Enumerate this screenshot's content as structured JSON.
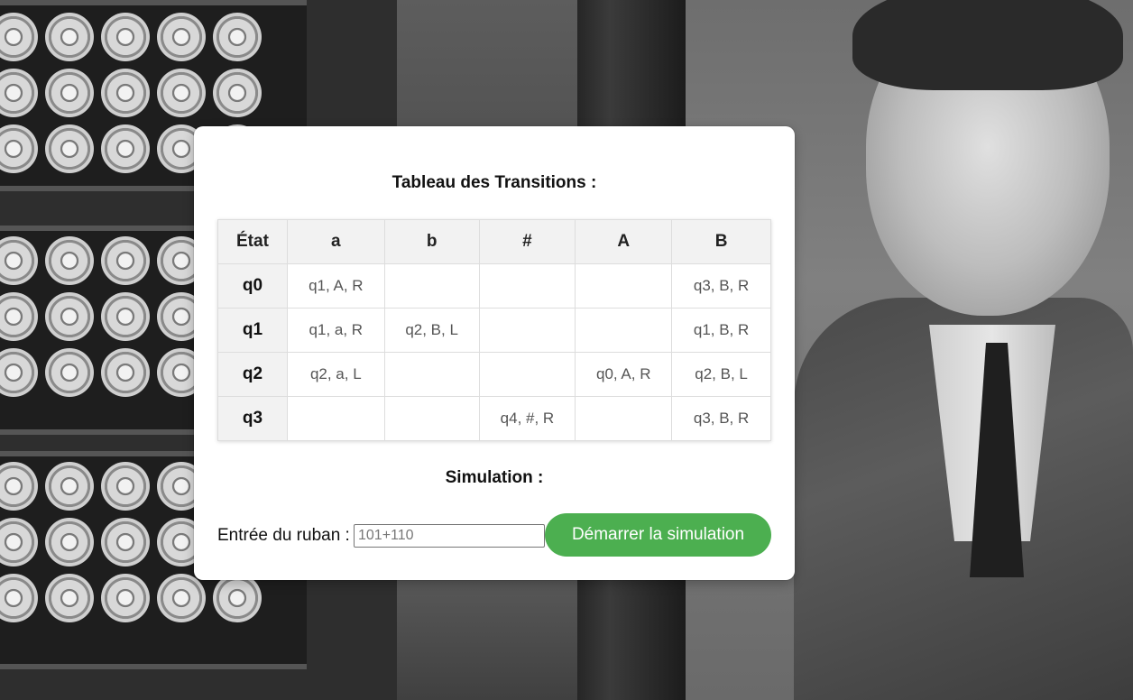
{
  "transitions": {
    "title": "Tableau des Transitions :",
    "headers": [
      "État",
      "a",
      "b",
      "#",
      "A",
      "B"
    ],
    "rows": [
      {
        "state": "q0",
        "cells": [
          "q1, A, R",
          "",
          "",
          "",
          "q3, B, R"
        ]
      },
      {
        "state": "q1",
        "cells": [
          "q1, a, R",
          "q2, B, L",
          "",
          "",
          "q1, B, R"
        ]
      },
      {
        "state": "q2",
        "cells": [
          "q2, a, L",
          "",
          "",
          "q0, A, R",
          "q2, B, L"
        ]
      },
      {
        "state": "q3",
        "cells": [
          "",
          "",
          "q4, #, R",
          "",
          "q3, B, R"
        ]
      }
    ]
  },
  "simulation": {
    "title": "Simulation :",
    "input_label": "Entrée du ruban :",
    "input_value": "",
    "input_placeholder": "101+110",
    "start_label": "Démarrer la simulation"
  },
  "colors": {
    "button": "#4caf50",
    "header_bg": "#f2f2f2",
    "border": "#dddddd"
  }
}
